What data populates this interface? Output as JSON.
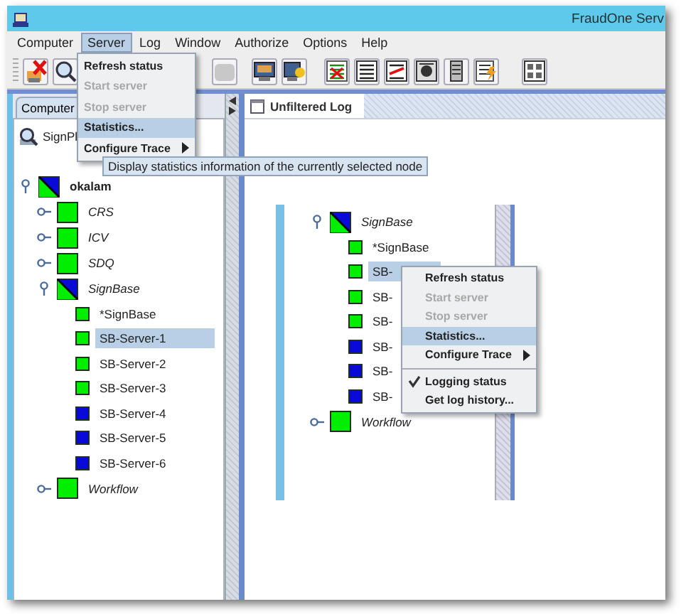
{
  "window": {
    "title": "FraudOne Serv"
  },
  "menu_bar": [
    {
      "label": "Computer",
      "selected": false
    },
    {
      "label": "Server",
      "selected": true
    },
    {
      "label": "Log",
      "selected": false
    },
    {
      "label": "Window",
      "selected": false
    },
    {
      "label": "Authorize",
      "selected": false
    },
    {
      "label": "Options",
      "selected": false
    },
    {
      "label": "Help",
      "selected": false
    }
  ],
  "server_menu": [
    {
      "kind": "item",
      "label": "Refresh status",
      "disabled": false,
      "selected": false
    },
    {
      "kind": "item",
      "label": "Start server",
      "disabled": true,
      "selected": false
    },
    {
      "kind": "item",
      "label": "Stop server",
      "disabled": true,
      "selected": false
    },
    {
      "kind": "item",
      "label": "Statistics...",
      "disabled": false,
      "selected": true
    },
    {
      "kind": "submenu",
      "label": "Configure Trace",
      "disabled": false,
      "selected": false
    }
  ],
  "tooltip": "Display statistics information of the currently selected node",
  "left_tab": {
    "label": "Computer"
  },
  "tree": [
    {
      "kind": "search",
      "label": "SignPl",
      "selected": false
    },
    {
      "kind": "computer",
      "label": "okalam",
      "color": "#0a0ad8",
      "mixed": true,
      "expanded": true,
      "selected": false,
      "children": [
        {
          "kind": "group",
          "label": "CRS",
          "color": "#00ee00",
          "mixed": false,
          "expanded": false,
          "selected": false
        },
        {
          "kind": "group",
          "label": "ICV",
          "color": "#00ee00",
          "mixed": false,
          "expanded": false,
          "selected": false
        },
        {
          "kind": "group",
          "label": "SDQ",
          "color": "#00ee00",
          "mixed": false,
          "expanded": false,
          "selected": false
        },
        {
          "kind": "group",
          "label": "SignBase",
          "color": "#0a0ad8",
          "mixed": true,
          "expanded": true,
          "selected": false,
          "children": [
            {
              "kind": "server",
              "label": "*SignBase",
              "color": "#00ee00",
              "selected": false
            },
            {
              "kind": "server",
              "label": "SB-Server-1",
              "color": "#00ee00",
              "selected": true
            },
            {
              "kind": "server",
              "label": "SB-Server-2",
              "color": "#00ee00",
              "selected": false
            },
            {
              "kind": "server",
              "label": "SB-Server-3",
              "color": "#00ee00",
              "selected": false
            },
            {
              "kind": "server",
              "label": "SB-Server-4",
              "color": "#0a0ad8",
              "selected": false
            },
            {
              "kind": "server",
              "label": "SB-Server-5",
              "color": "#0a0ad8",
              "selected": false
            },
            {
              "kind": "server",
              "label": "SB-Server-6",
              "color": "#0a0ad8",
              "selected": false
            }
          ]
        },
        {
          "kind": "group",
          "label": "Workflow",
          "color": "#00ee00",
          "mixed": false,
          "expanded": false,
          "selected": false
        }
      ]
    }
  ],
  "right_tab": {
    "label": "Unfiltered Log"
  },
  "inset_tree": [
    {
      "kind": "group",
      "label": "SignBase",
      "color": "#0a0ad8",
      "mixed": true,
      "expanded": true,
      "selected": false,
      "children": [
        {
          "kind": "server",
          "label": "*SignBase",
          "color": "#00ee00",
          "selected": false
        },
        {
          "kind": "server",
          "label": "SB-",
          "color": "#00ee00",
          "selected": true
        },
        {
          "kind": "server",
          "label": "SB-",
          "color": "#00ee00",
          "selected": false
        },
        {
          "kind": "server",
          "label": "SB-",
          "color": "#00ee00",
          "selected": false
        },
        {
          "kind": "server",
          "label": "SB-",
          "color": "#0a0ad8",
          "selected": false
        },
        {
          "kind": "server",
          "label": "SB-",
          "color": "#0a0ad8",
          "selected": false
        },
        {
          "kind": "server",
          "label": "SB-",
          "color": "#0a0ad8",
          "selected": false
        }
      ]
    },
    {
      "kind": "group",
      "label": "Workflow",
      "color": "#00ee00",
      "mixed": false,
      "expanded": false,
      "selected": false
    }
  ],
  "context_menu": [
    {
      "kind": "item",
      "label": "Refresh status",
      "disabled": false,
      "selected": false
    },
    {
      "kind": "item",
      "label": "Start server",
      "disabled": true,
      "selected": false
    },
    {
      "kind": "item",
      "label": "Stop server",
      "disabled": true,
      "selected": false
    },
    {
      "kind": "item",
      "label": "Statistics...",
      "disabled": false,
      "selected": true
    },
    {
      "kind": "submenu",
      "label": "Configure Trace",
      "disabled": false,
      "selected": false
    },
    {
      "kind": "separator"
    },
    {
      "kind": "check",
      "label": "Logging status",
      "checked": true,
      "disabled": false,
      "selected": false
    },
    {
      "kind": "item",
      "label": "Get log history...",
      "disabled": false,
      "selected": false
    }
  ]
}
